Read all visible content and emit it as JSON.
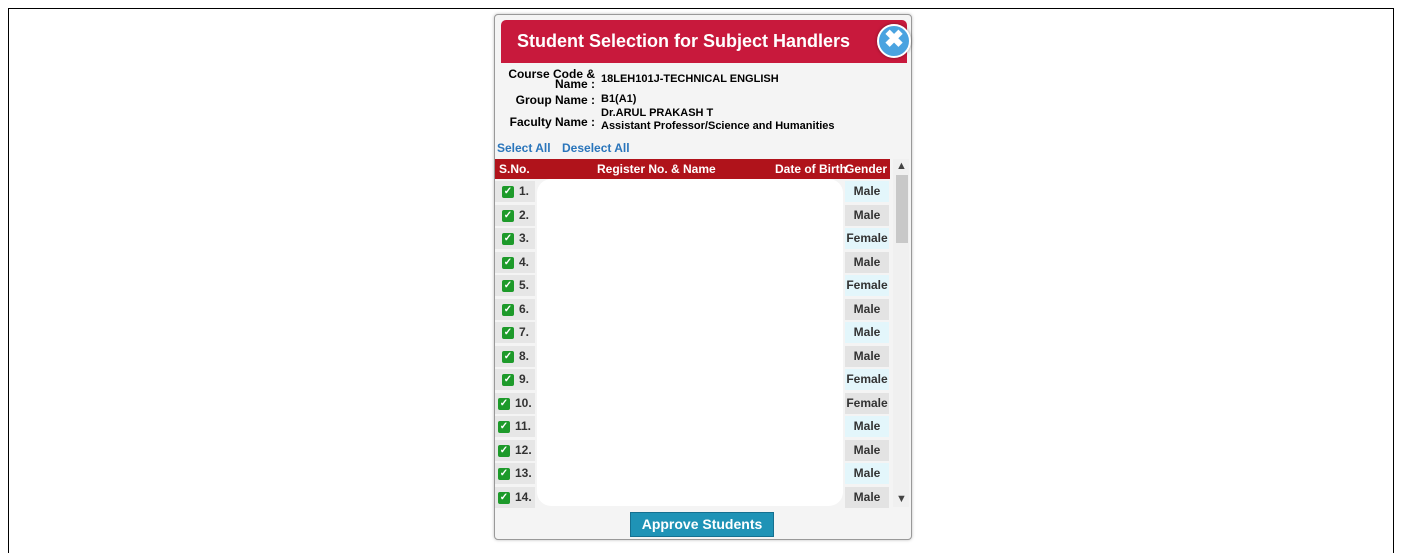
{
  "dialog": {
    "title": "Student Selection for Subject Handlers",
    "close_icon": "✖",
    "course_label_line1": "Course Code &",
    "course_label_line2": "Name :",
    "course_value": "18LEH101J-TECHNICAL ENGLISH",
    "group_label": "Group Name :",
    "group_value": "B1(A1)",
    "faculty_label": "Faculty Name :",
    "faculty_name": "Dr.ARUL PRAKASH T",
    "faculty_designation": "Assistant Professor/Science and Humanities",
    "select_all": "Select All",
    "deselect_all": "Deselect All",
    "approve_button": "Approve Students"
  },
  "table": {
    "columns": [
      "S.No.",
      "Register No. & Name",
      "Date of Birth",
      "Gender"
    ],
    "rows": [
      {
        "sno": "1.",
        "gender": "Male"
      },
      {
        "sno": "2.",
        "gender": "Male"
      },
      {
        "sno": "3.",
        "gender": "Female"
      },
      {
        "sno": "4.",
        "gender": "Male"
      },
      {
        "sno": "5.",
        "gender": "Female"
      },
      {
        "sno": "6.",
        "gender": "Male"
      },
      {
        "sno": "7.",
        "gender": "Male"
      },
      {
        "sno": "8.",
        "gender": "Male"
      },
      {
        "sno": "9.",
        "gender": "Female"
      },
      {
        "sno": "10.",
        "gender": "Female"
      },
      {
        "sno": "11.",
        "gender": "Male"
      },
      {
        "sno": "12.",
        "gender": "Male"
      },
      {
        "sno": "13.",
        "gender": "Male"
      },
      {
        "sno": "14.",
        "gender": "Male"
      }
    ]
  },
  "colors": {
    "header_red": "#c8193c",
    "table_head_red": "#b0131b",
    "link_blue": "#2a75bb",
    "button_teal": "#1f93b6",
    "checkbox_green": "#1d9a2a"
  }
}
